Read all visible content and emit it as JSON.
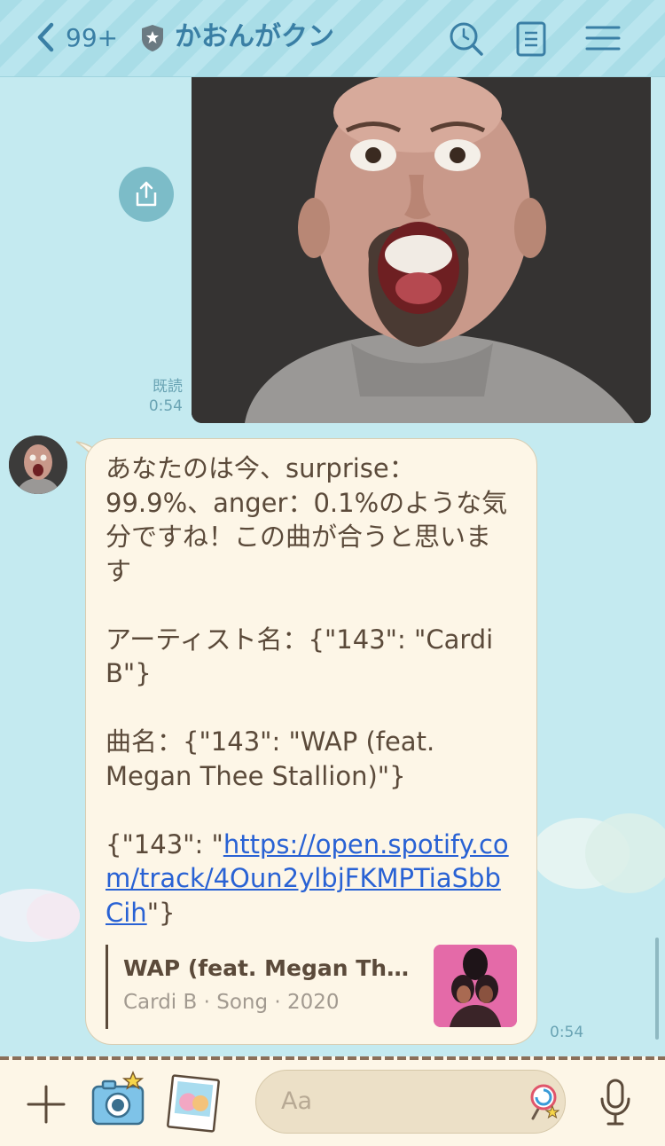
{
  "header": {
    "unread_count": "99+",
    "title": "かおんがクン",
    "accent": "#3a7fa5"
  },
  "messages": {
    "sent_image_status": "既読",
    "sent_image_time": "0:54",
    "reply_text_lines": [
      "あなたの",
      "は今、surprise：99.9%、anger：0.1%のような気分ですね！この曲が合うと思います",
      "",
      "アーティスト名：{\"143\": \"Cardi B\"}",
      "",
      "曲名：{\"143\": \"WAP (feat. Megan Thee Stallion)\"}",
      ""
    ],
    "reply_text": "あなたのは今、surprise：\n99.9%、anger：0.1%のような気\n分ですね！この曲が合うと思いま\nす\n\nアーティスト名：{\"143\": \"Cardi\nB\"}\n\n曲名：{\"143\": \"WAP (feat.\nMegan Thee Stallion)\"}\n\n",
    "link_prefix": "{\"143\": \"",
    "link_text": "https://open.spotify.com/track/4Oun2ylbjFKMPTiaSbbCih",
    "link_suffix": "\"}",
    "preview_title": "WAP (feat. Megan Thee Stallion)",
    "preview_subtitle": "Cardi B · Song · 2020",
    "reply_time": "0:54"
  },
  "footer": {
    "input_placeholder": "Aa"
  }
}
